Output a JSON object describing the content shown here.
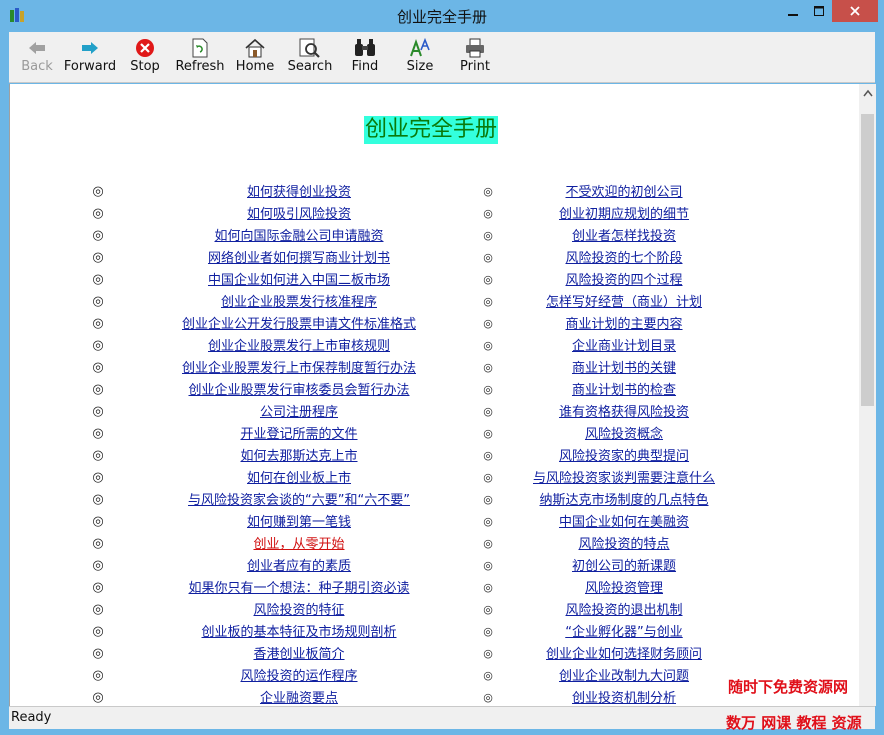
{
  "window": {
    "title": "创业完全手册"
  },
  "toolbar": [
    {
      "label": "Back",
      "icon": "back-arrow-icon",
      "enabled": false
    },
    {
      "label": "Forward",
      "icon": "forward-arrow-icon",
      "enabled": true
    },
    {
      "label": "Stop",
      "icon": "stop-icon",
      "enabled": true
    },
    {
      "label": "Refresh",
      "icon": "refresh-icon",
      "enabled": true
    },
    {
      "label": "Home",
      "icon": "home-icon",
      "enabled": true
    },
    {
      "label": "Search",
      "icon": "search-icon",
      "enabled": true
    },
    {
      "label": "Find",
      "icon": "binoculars-icon",
      "enabled": true
    },
    {
      "label": "Size",
      "icon": "font-size-icon",
      "enabled": true
    },
    {
      "label": "Print",
      "icon": "printer-icon",
      "enabled": true
    }
  ],
  "page": {
    "heading": "创业完全手册",
    "left_links": [
      "如何获得创业投资",
      "如何吸引风险投资",
      "如何向国际金融公司申请融资",
      "网络创业者如何撰写商业计划书",
      "中国企业如何进入中国二板市场",
      "创业企业股票发行核准程序",
      "创业企业公开发行股票申请文件标准格式",
      "创业企业股票发行上市审核规则",
      "创业企业股票发行上市保荐制度暂行办法",
      "创业企业股票发行审核委员会暂行办法",
      "公司注册程序",
      "开业登记所需的文件",
      "如何去那斯达克上市",
      "如何在创业板上市",
      "与风险投资家会谈的“六要”和“六不要”",
      "如何赚到第一笔钱",
      "创业，从零开始",
      "创业者应有的素质",
      "如果你只有一个想法：种子期引资必读",
      "风险投资的特征",
      "创业板的基本特征及市场规则剖析",
      "香港创业板简介",
      "风险投资的运作程序",
      "企业融资要点"
    ],
    "right_links": [
      "不受欢迎的初创公司",
      "创业初期应规划的细节",
      "创业者怎样找投资",
      "风险投资的七个阶段",
      "风险投资的四个过程",
      "怎样写好经营（商业）计划",
      "商业计划的主要内容",
      "企业商业计划目录",
      "商业计划书的关键",
      "商业计划书的检查",
      "谁有资格获得风险投资",
      "风险投资概念",
      "风险投资家的典型提问",
      "与风险投资家谈判需要注意什么",
      "纳斯达克市场制度的几点特色",
      "中国企业如何在美融资",
      "风险投资的特点",
      "初创公司的新课题",
      "风险投资管理",
      "风险投资的退出机制",
      "“企业孵化器”与创业",
      "创业企业如何选择财务顾问",
      "创业企业改制九大问题",
      "创业投资机制分析"
    ],
    "visited_link_index": 16
  },
  "statusbar": {
    "text": "Ready"
  },
  "watermark": {
    "line1": "随时下免费资源网",
    "line2": "数万 网课 教程 资源"
  },
  "colors": {
    "accent": "#6cb6e6",
    "heading_bg": "#33ffdd",
    "heading_text": "#0a7a0a",
    "link": "#1020a0",
    "visited": "#d01010"
  }
}
